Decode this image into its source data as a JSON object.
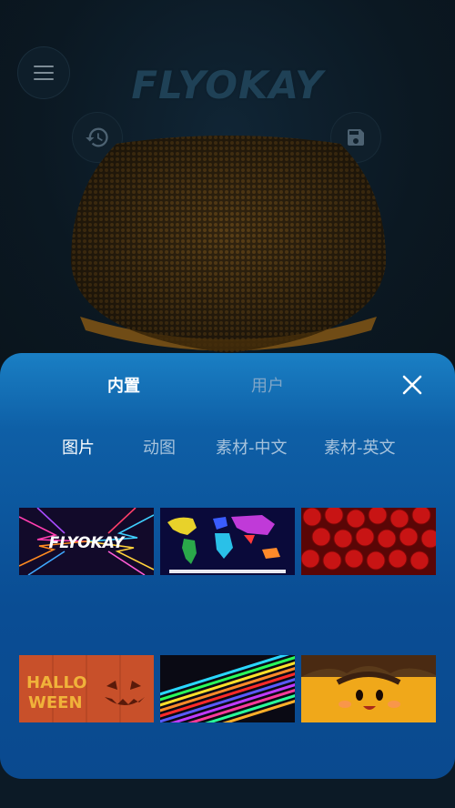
{
  "header": {
    "logo_text": "FLYOKAY",
    "menu_icon": "menu-icon",
    "history_icon": "history-icon",
    "save_icon": "save-icon"
  },
  "panel": {
    "tabs": [
      {
        "label": "内置",
        "active": true
      },
      {
        "label": "用户",
        "active": false
      }
    ],
    "subtabs": [
      {
        "label": "图片",
        "active": true
      },
      {
        "label": "动图",
        "active": false
      },
      {
        "label": "素材-中文",
        "active": false
      },
      {
        "label": "素材-英文",
        "active": false
      }
    ],
    "close_icon": "close-icon",
    "thumbnails": [
      {
        "name": "flyokay-lightning",
        "text": "FLYOKAY"
      },
      {
        "name": "world-map",
        "text": ""
      },
      {
        "name": "red-roses",
        "text": ""
      },
      {
        "name": "halloween",
        "text": "HALLO WEEN"
      },
      {
        "name": "rainbow-stripes",
        "text": ""
      },
      {
        "name": "cartoon-face",
        "text": ""
      }
    ]
  },
  "colors": {
    "panel_top": "#1a7fc4",
    "panel_bottom": "#0a4a8f",
    "background": "#0c1a26"
  }
}
